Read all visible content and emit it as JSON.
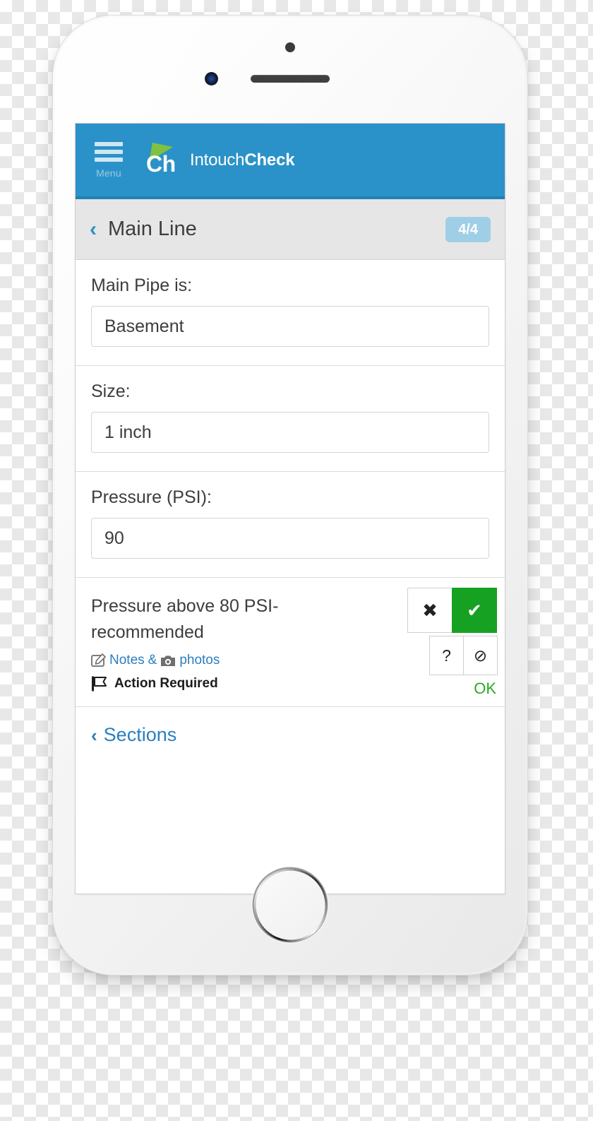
{
  "app": {
    "header": {
      "menu_label": "Menu",
      "brand_first": "Intouch",
      "brand_second": "Check",
      "brand_mark": "Ch",
      "background_color": "#2a92c8"
    },
    "sub_header": {
      "back_chevron": "‹",
      "title": "Main Line",
      "count_badge": "4/4",
      "badge_color": "#9fcfe6"
    },
    "fields": [
      {
        "label": "Main Pipe is:",
        "value": "Basement",
        "placeholder": ""
      },
      {
        "label": "Size:",
        "value": "1 inch",
        "placeholder": ""
      },
      {
        "label": "Pressure (PSI):",
        "value": "90",
        "placeholder": ""
      }
    ],
    "question": {
      "text": "Pressure above 80 PSI-recommended",
      "notes_label": "Notes",
      "amp_label": "&",
      "photos_label": "photos",
      "action_label": "Action Required",
      "status_label": "OK",
      "status_color": "#2aa82a",
      "buttons": {
        "fail": "✖",
        "pass": "✔",
        "unknown": "?",
        "na": "⊘"
      },
      "selected": "pass",
      "selected_color": "#16a122"
    },
    "footer": {
      "sections_chevron": "‹",
      "sections_label": "Sections"
    }
  }
}
